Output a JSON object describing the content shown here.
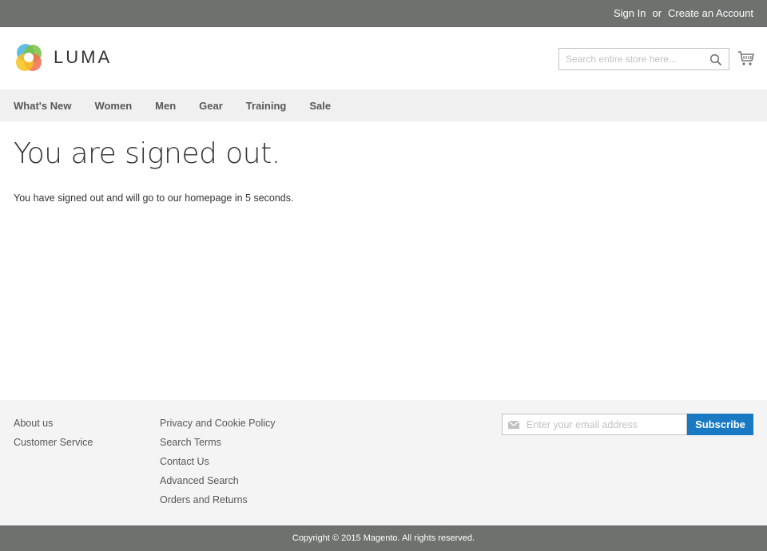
{
  "topbar": {
    "sign_in": "Sign In",
    "or": "or",
    "create_account": "Create an Account"
  },
  "header": {
    "brand": "LUMA",
    "search": {
      "placeholder": "Search entire store here..."
    },
    "icons": {
      "search": "search-icon",
      "cart": "cart-icon"
    }
  },
  "nav": {
    "items": [
      {
        "label": "What's New"
      },
      {
        "label": "Women"
      },
      {
        "label": "Men"
      },
      {
        "label": "Gear"
      },
      {
        "label": "Training"
      },
      {
        "label": "Sale"
      }
    ]
  },
  "main": {
    "title": "You are signed out.",
    "message": "You have signed out and will go to our homepage in 5 seconds."
  },
  "footer": {
    "col1": [
      {
        "label": "About us"
      },
      {
        "label": "Customer Service"
      }
    ],
    "col2": [
      {
        "label": "Privacy and Cookie Policy"
      },
      {
        "label": "Search Terms"
      },
      {
        "label": "Contact Us"
      },
      {
        "label": "Advanced Search"
      },
      {
        "label": "Orders and Returns"
      }
    ],
    "newsletter": {
      "placeholder": "Enter your email address",
      "button": "Subscribe"
    },
    "copyright": "Copyright © 2015 Magento. All rights reserved."
  },
  "colors": {
    "topbar": "#6e716e",
    "nav": "#f0f0f0",
    "footer": "#f4f4f4",
    "accent": "#1979c3"
  }
}
